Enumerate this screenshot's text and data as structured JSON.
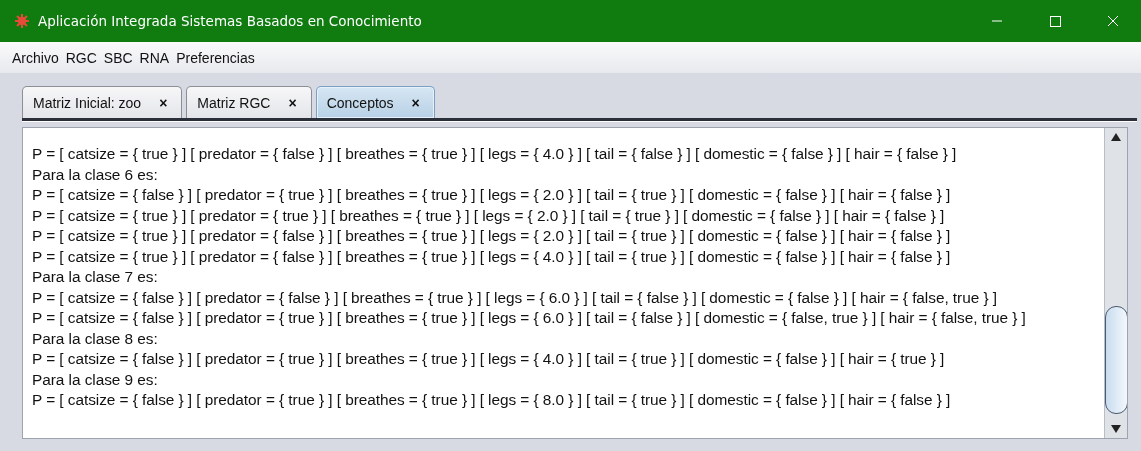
{
  "window": {
    "title": "Aplicación Integrada Sistemas Basados en Conocimiento"
  },
  "menu": [
    "Archivo",
    "RGC",
    "SBC",
    "RNA",
    "Preferencias"
  ],
  "tabs": [
    {
      "label": "Matriz Inicial: zoo",
      "selected": false
    },
    {
      "label": "Matriz RGC",
      "selected": false
    },
    {
      "label": "Conceptos",
      "selected": true
    }
  ],
  "close_glyph": "×",
  "lines": [
    "P = [ catsize = { true } ] [ predator = { false } ] [ breathes = { true } ] [ legs = { 4.0 } ] [ tail = { false } ] [ domestic = { false } ] [ hair = { false } ]",
    "Para la clase 6 es:",
    "P = [ catsize = { false } ] [ predator = { true } ] [ breathes = { true } ] [ legs = { 2.0 } ] [ tail = { true } ] [ domestic = { false } ] [ hair = { false } ]",
    "P = [ catsize = { true } ] [ predator = { true } ] [ breathes = { true } ] [ legs = { 2.0 } ] [ tail = { true } ] [ domestic = { false } ] [ hair = { false } ]",
    "P = [ catsize = { true } ] [ predator = { false } ] [ breathes = { true } ] [ legs = { 2.0 } ] [ tail = { true } ] [ domestic = { false } ] [ hair = { false } ]",
    "P = [ catsize = { true } ] [ predator = { false } ] [ breathes = { true } ] [ legs = { 4.0 } ] [ tail = { true } ] [ domestic = { false } ] [ hair = { false } ]",
    "Para la clase 7 es:",
    "P = [ catsize = { false } ] [ predator = { false } ] [ breathes = { true } ] [ legs = { 6.0 } ] [ tail = { false } ] [ domestic = { false } ] [ hair = { false, true } ]",
    "P = [ catsize = { false } ] [ predator = { true } ] [ breathes = { true } ] [ legs = { 6.0 } ] [ tail = { false } ] [ domestic = { false, true } ] [ hair = { false, true } ]",
    "Para la clase 8 es:",
    "P = [ catsize = { false } ] [ predator = { true } ] [ breathes = { true } ] [ legs = { 4.0 } ] [ tail = { true } ] [ domestic = { false } ] [ hair = { true } ]",
    "Para la clase 9 es:",
    "P = [ catsize = { false } ] [ predator = { true } ] [ breathes = { true } ] [ legs = { 8.0 } ] [ tail = { true } ] [ domestic = { false } ] [ hair = { false } ]"
  ]
}
